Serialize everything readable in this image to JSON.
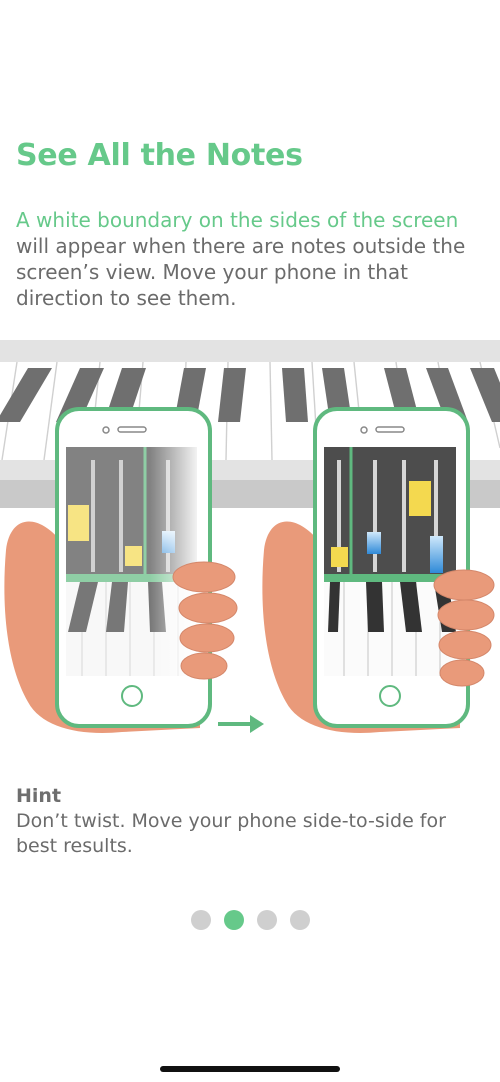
{
  "onboarding": {
    "title": "See All the Notes",
    "description_highlight": "A white boundary on the sides of the screen",
    "description_rest": "will appear when there are notes outside the screen’s view. Move your phone in that direction to see them.",
    "hint_title": "Hint",
    "hint_text": "Don’t twist. Move your phone side-to-side for best results.",
    "pagination": {
      "total": 4,
      "active_index": 1
    }
  },
  "icons": {
    "arrow": "right-arrow-icon",
    "home_button": "phone-home-button-icon"
  },
  "colors": {
    "accent": "#66c98a",
    "text": "#6b6b6b",
    "dot_inactive": "#cfcfcf",
    "skin": "#e99a7a",
    "note_yellow": "#f4d94f",
    "note_blue": "#4a9fe0"
  }
}
